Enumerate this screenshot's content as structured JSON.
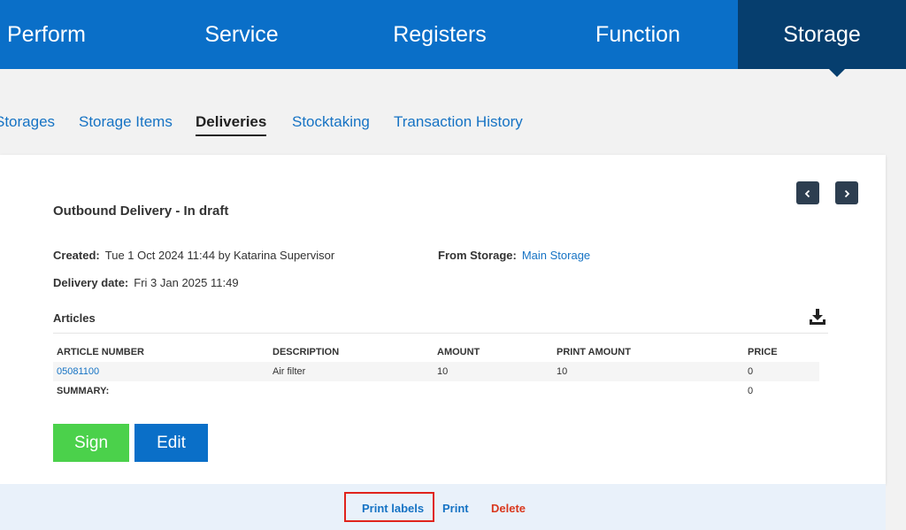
{
  "topnav": {
    "items": [
      "Perform",
      "Service",
      "Registers",
      "Function",
      "Storage"
    ],
    "active": "Storage"
  },
  "subnav": {
    "tabs": [
      "Storages",
      "Storage Items",
      "Deliveries",
      "Stocktaking",
      "Transaction History"
    ],
    "active": "Deliveries"
  },
  "delivery": {
    "title": "Outbound Delivery - In draft",
    "created_label": "Created:",
    "created_value": "Tue 1 Oct 2024 11:44 by Katarina Supervisor",
    "from_storage_label": "From Storage:",
    "from_storage_value": "Main Storage",
    "delivery_date_label": "Delivery date:",
    "delivery_date_value": "Fri 3 Jan 2025 11:49"
  },
  "articles": {
    "heading": "Articles",
    "download_icon": "download-icon",
    "columns": [
      "ARTICLE NUMBER",
      "DESCRIPTION",
      "AMOUNT",
      "PRINT AMOUNT",
      "PRICE"
    ],
    "rows": [
      {
        "article_number": "05081100",
        "description": "Air filter",
        "amount": "10",
        "print_amount": "10",
        "price": "0"
      }
    ],
    "summary_label": "SUMMARY:",
    "summary_price": "0"
  },
  "actions": {
    "sign_label": "Sign",
    "edit_label": "Edit",
    "print_labels_label": "Print labels",
    "print_label": "Print",
    "delete_label": "Delete"
  },
  "nav_icons": {
    "prev": "chevron-left-icon",
    "next": "chevron-right-icon"
  },
  "colors": {
    "nav_blue": "#0a6fc8",
    "nav_active": "#063e6e",
    "link_blue": "#1673c4",
    "sign_green": "#4bd14b",
    "delete_red": "#d9381e",
    "highlight_red": "#e0231c"
  }
}
